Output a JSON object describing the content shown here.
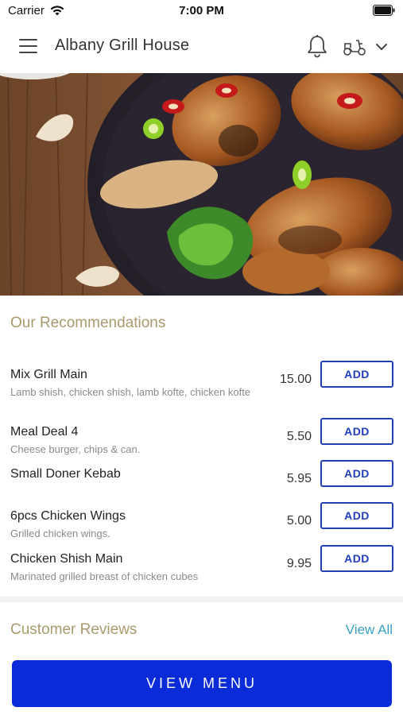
{
  "status_bar": {
    "carrier": "Carrier",
    "time": "7:00 PM"
  },
  "header": {
    "title": "Albany Grill House",
    "icons": [
      "menu-icon",
      "bell-icon",
      "scooter-icon",
      "chevron-down-icon"
    ]
  },
  "hero": {
    "image": "grilled-chicken-wings-photo"
  },
  "recommendations": {
    "title": "Our Recommendations",
    "add_label": "ADD",
    "items": [
      {
        "name": "Mix Grill Main",
        "description": "Lamb shish, chicken shish, lamb kofte, chicken kofte",
        "price": "15.00"
      },
      {
        "name": "Meal Deal 4",
        "description": "Cheese burger, chips & can.",
        "price": "5.50"
      },
      {
        "name": "Small Doner Kebab",
        "description": "",
        "price": "5.95"
      },
      {
        "name": "6pcs Chicken Wings",
        "description": "Grilled chicken wings.",
        "price": "5.00"
      },
      {
        "name": "Chicken Shish Main",
        "description": "Marinated grilled breast of chicken cubes",
        "price": "9.95"
      }
    ]
  },
  "reviews": {
    "title": "Customer Reviews",
    "view_all_label": "View All"
  },
  "footer": {
    "view_menu_label": "VIEW MENU"
  },
  "colors": {
    "accent_blue": "#0a2cd8",
    "section_title": "#a89a6c",
    "link": "#3aa0c0"
  }
}
